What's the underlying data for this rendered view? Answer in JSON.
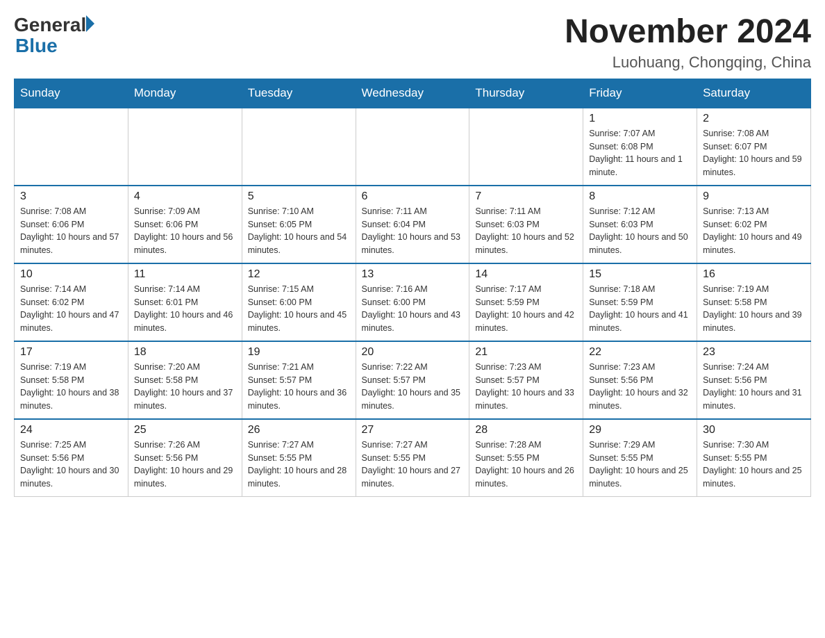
{
  "header": {
    "logo_general": "General",
    "logo_blue": "Blue",
    "month_title": "November 2024",
    "location": "Luohuang, Chongqing, China"
  },
  "days_of_week": [
    "Sunday",
    "Monday",
    "Tuesday",
    "Wednesday",
    "Thursday",
    "Friday",
    "Saturday"
  ],
  "weeks": [
    [
      {
        "day": "",
        "info": ""
      },
      {
        "day": "",
        "info": ""
      },
      {
        "day": "",
        "info": ""
      },
      {
        "day": "",
        "info": ""
      },
      {
        "day": "",
        "info": ""
      },
      {
        "day": "1",
        "info": "Sunrise: 7:07 AM\nSunset: 6:08 PM\nDaylight: 11 hours and 1 minute."
      },
      {
        "day": "2",
        "info": "Sunrise: 7:08 AM\nSunset: 6:07 PM\nDaylight: 10 hours and 59 minutes."
      }
    ],
    [
      {
        "day": "3",
        "info": "Sunrise: 7:08 AM\nSunset: 6:06 PM\nDaylight: 10 hours and 57 minutes."
      },
      {
        "day": "4",
        "info": "Sunrise: 7:09 AM\nSunset: 6:06 PM\nDaylight: 10 hours and 56 minutes."
      },
      {
        "day": "5",
        "info": "Sunrise: 7:10 AM\nSunset: 6:05 PM\nDaylight: 10 hours and 54 minutes."
      },
      {
        "day": "6",
        "info": "Sunrise: 7:11 AM\nSunset: 6:04 PM\nDaylight: 10 hours and 53 minutes."
      },
      {
        "day": "7",
        "info": "Sunrise: 7:11 AM\nSunset: 6:03 PM\nDaylight: 10 hours and 52 minutes."
      },
      {
        "day": "8",
        "info": "Sunrise: 7:12 AM\nSunset: 6:03 PM\nDaylight: 10 hours and 50 minutes."
      },
      {
        "day": "9",
        "info": "Sunrise: 7:13 AM\nSunset: 6:02 PM\nDaylight: 10 hours and 49 minutes."
      }
    ],
    [
      {
        "day": "10",
        "info": "Sunrise: 7:14 AM\nSunset: 6:02 PM\nDaylight: 10 hours and 47 minutes."
      },
      {
        "day": "11",
        "info": "Sunrise: 7:14 AM\nSunset: 6:01 PM\nDaylight: 10 hours and 46 minutes."
      },
      {
        "day": "12",
        "info": "Sunrise: 7:15 AM\nSunset: 6:00 PM\nDaylight: 10 hours and 45 minutes."
      },
      {
        "day": "13",
        "info": "Sunrise: 7:16 AM\nSunset: 6:00 PM\nDaylight: 10 hours and 43 minutes."
      },
      {
        "day": "14",
        "info": "Sunrise: 7:17 AM\nSunset: 5:59 PM\nDaylight: 10 hours and 42 minutes."
      },
      {
        "day": "15",
        "info": "Sunrise: 7:18 AM\nSunset: 5:59 PM\nDaylight: 10 hours and 41 minutes."
      },
      {
        "day": "16",
        "info": "Sunrise: 7:19 AM\nSunset: 5:58 PM\nDaylight: 10 hours and 39 minutes."
      }
    ],
    [
      {
        "day": "17",
        "info": "Sunrise: 7:19 AM\nSunset: 5:58 PM\nDaylight: 10 hours and 38 minutes."
      },
      {
        "day": "18",
        "info": "Sunrise: 7:20 AM\nSunset: 5:58 PM\nDaylight: 10 hours and 37 minutes."
      },
      {
        "day": "19",
        "info": "Sunrise: 7:21 AM\nSunset: 5:57 PM\nDaylight: 10 hours and 36 minutes."
      },
      {
        "day": "20",
        "info": "Sunrise: 7:22 AM\nSunset: 5:57 PM\nDaylight: 10 hours and 35 minutes."
      },
      {
        "day": "21",
        "info": "Sunrise: 7:23 AM\nSunset: 5:57 PM\nDaylight: 10 hours and 33 minutes."
      },
      {
        "day": "22",
        "info": "Sunrise: 7:23 AM\nSunset: 5:56 PM\nDaylight: 10 hours and 32 minutes."
      },
      {
        "day": "23",
        "info": "Sunrise: 7:24 AM\nSunset: 5:56 PM\nDaylight: 10 hours and 31 minutes."
      }
    ],
    [
      {
        "day": "24",
        "info": "Sunrise: 7:25 AM\nSunset: 5:56 PM\nDaylight: 10 hours and 30 minutes."
      },
      {
        "day": "25",
        "info": "Sunrise: 7:26 AM\nSunset: 5:56 PM\nDaylight: 10 hours and 29 minutes."
      },
      {
        "day": "26",
        "info": "Sunrise: 7:27 AM\nSunset: 5:55 PM\nDaylight: 10 hours and 28 minutes."
      },
      {
        "day": "27",
        "info": "Sunrise: 7:27 AM\nSunset: 5:55 PM\nDaylight: 10 hours and 27 minutes."
      },
      {
        "day": "28",
        "info": "Sunrise: 7:28 AM\nSunset: 5:55 PM\nDaylight: 10 hours and 26 minutes."
      },
      {
        "day": "29",
        "info": "Sunrise: 7:29 AM\nSunset: 5:55 PM\nDaylight: 10 hours and 25 minutes."
      },
      {
        "day": "30",
        "info": "Sunrise: 7:30 AM\nSunset: 5:55 PM\nDaylight: 10 hours and 25 minutes."
      }
    ]
  ]
}
